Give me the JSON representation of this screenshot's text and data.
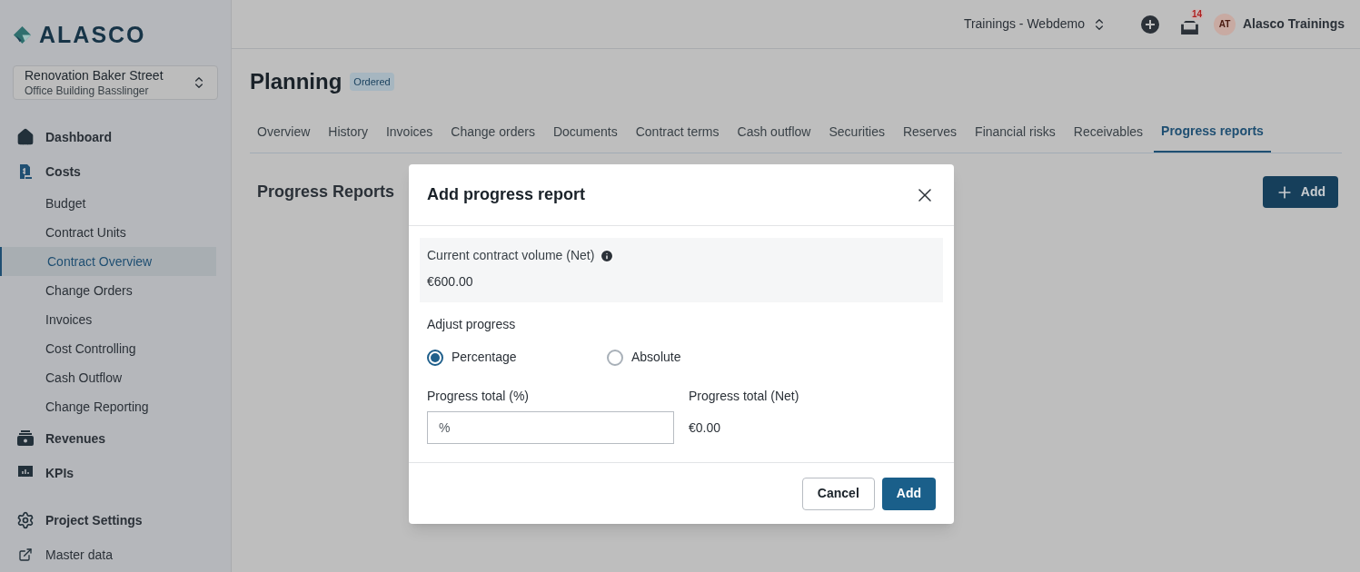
{
  "logo": {
    "text": "ALASCO"
  },
  "project_selector": {
    "title": "Renovation Baker Street",
    "subtitle": "Office Building Basslinger"
  },
  "sidebar": {
    "items": [
      {
        "label": "Dashboard",
        "selected": false
      },
      {
        "label": "Costs",
        "selected": false,
        "children": [
          {
            "label": "Budget",
            "selected": false
          },
          {
            "label": "Contract Units",
            "selected": false
          },
          {
            "label": "Contract Overview",
            "selected": true
          },
          {
            "label": "Change Orders",
            "selected": false
          },
          {
            "label": "Invoices",
            "selected": false
          },
          {
            "label": "Cost Controlling",
            "selected": false
          },
          {
            "label": "Cash Outflow",
            "selected": false
          },
          {
            "label": "Change Reporting",
            "selected": false
          }
        ]
      },
      {
        "label": "Revenues",
        "selected": false
      },
      {
        "label": "KPIs",
        "selected": false
      }
    ],
    "footer_items": [
      {
        "label": "Project Settings"
      },
      {
        "label": "Master data"
      }
    ]
  },
  "topbar": {
    "workspace": "Trainings - Webdemo",
    "notification_count": "14",
    "avatar_initials": "AT",
    "user_name": "Alasco Trainings"
  },
  "page": {
    "title": "Planning",
    "status": "Ordered",
    "tabs": [
      {
        "label": "Overview",
        "selected": false
      },
      {
        "label": "History",
        "selected": false
      },
      {
        "label": "Invoices",
        "selected": false
      },
      {
        "label": "Change orders",
        "selected": false
      },
      {
        "label": "Documents",
        "selected": false
      },
      {
        "label": "Contract terms",
        "selected": false
      },
      {
        "label": "Cash outflow",
        "selected": false
      },
      {
        "label": "Securities",
        "selected": false
      },
      {
        "label": "Reserves",
        "selected": false
      },
      {
        "label": "Financial risks",
        "selected": false
      },
      {
        "label": "Receivables",
        "selected": false
      },
      {
        "label": "Progress reports",
        "selected": true
      }
    ],
    "section_title": "Progress Reports",
    "add_button": "Add"
  },
  "dialog": {
    "title": "Add progress report",
    "volume_label": "Current contract volume (Net)",
    "volume_value": "€600.00",
    "adjust_label": "Adjust progress",
    "options": [
      {
        "label": "Percentage",
        "selected": true
      },
      {
        "label": "Absolute",
        "selected": false
      }
    ],
    "percent_label": "Progress total (%)",
    "percent_placeholder": "%",
    "net_label": "Progress total (Net)",
    "net_value": "€0.00",
    "buttons": [
      {
        "label": "Cancel",
        "kind": "secondary"
      },
      {
        "label": "Add",
        "kind": "primary"
      }
    ]
  }
}
